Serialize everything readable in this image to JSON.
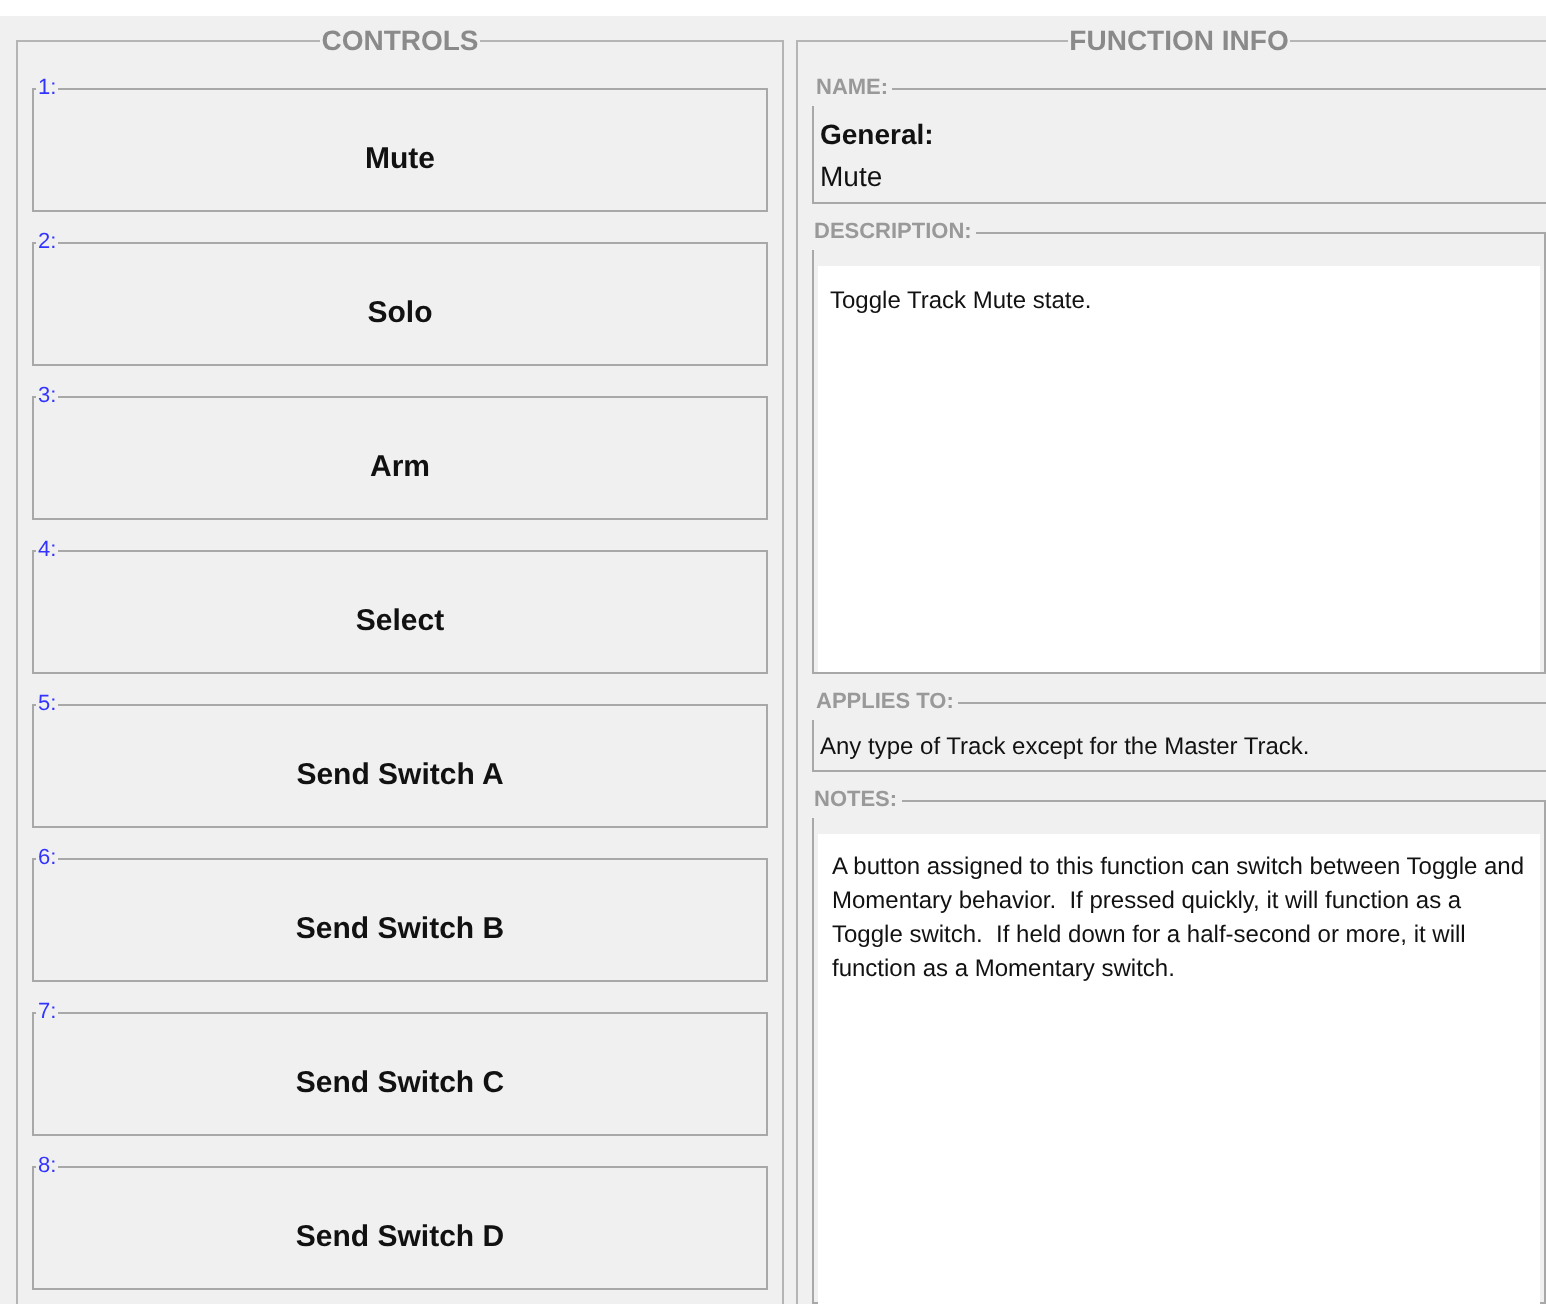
{
  "controls_panel": {
    "title": "CONTROLS",
    "controls": [
      {
        "number": "1:",
        "label": "Mute"
      },
      {
        "number": "2:",
        "label": "Solo"
      },
      {
        "number": "3:",
        "label": "Arm"
      },
      {
        "number": "4:",
        "label": "Select"
      },
      {
        "number": "5:",
        "label": "Send Switch A"
      },
      {
        "number": "6:",
        "label": "Send Switch B"
      },
      {
        "number": "7:",
        "label": "Send Switch C"
      },
      {
        "number": "8:",
        "label": "Send Switch D"
      }
    ]
  },
  "function_info": {
    "title": "FUNCTION INFO",
    "name": {
      "legend": "NAME:",
      "category": "General:",
      "value": "Mute"
    },
    "description": {
      "legend": "DESCRIPTION:",
      "text": "Toggle Track Mute state."
    },
    "applies_to": {
      "legend": "APPLIES TO:",
      "text": "Any type of Track except for the Master Track."
    },
    "notes": {
      "legend": "NOTES:",
      "text": "A button assigned to this function can switch between Toggle and Momentary behavior.  If pressed quickly, it will function as a Toggle switch.  If held down for a half-second or more, it will function as a Momentary switch."
    }
  }
}
